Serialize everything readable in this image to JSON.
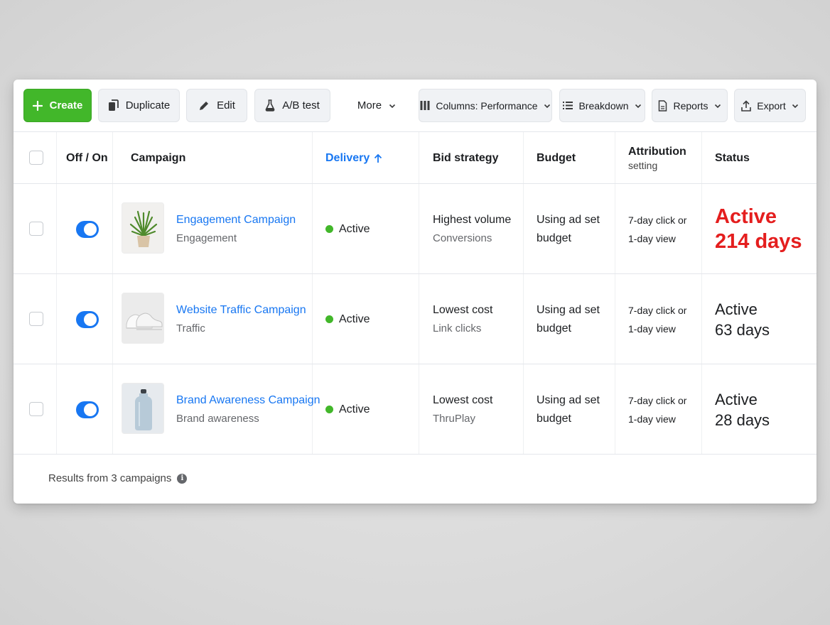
{
  "toolbar": {
    "create_label": "Create",
    "duplicate_label": "Duplicate",
    "edit_label": "Edit",
    "ab_test_label": "A/B test",
    "more_label": "More",
    "columns_label": "Columns: Performance",
    "breakdown_label": "Breakdown",
    "reports_label": "Reports",
    "export_label": "Export"
  },
  "table": {
    "headers": {
      "off_on": "Off / On",
      "campaign": "Campaign",
      "delivery": "Delivery",
      "bid_strategy": "Bid strategy",
      "budget": "Budget",
      "attribution": "Attribution",
      "attribution_sub": "setting",
      "status": "Status"
    },
    "rows": [
      {
        "name": "Engagement Campaign",
        "objective": "Engagement",
        "thumbnail": "plant",
        "enabled": true,
        "delivery": "Active",
        "bid_strategy": "Highest volume",
        "bid_sub": "Conversions",
        "budget_line1": "Using ad set",
        "budget_line2": "budget",
        "attribution_line1": "7-day click or",
        "attribution_line2": "1-day view",
        "status_line1": "Active",
        "status_line2": "214 days",
        "status_color": "#e41e1e"
      },
      {
        "name": "Website Traffic Campaign",
        "objective": "Traffic",
        "thumbnail": "sneakers",
        "enabled": true,
        "delivery": "Active",
        "bid_strategy": "Lowest cost",
        "bid_sub": "Link clicks",
        "budget_line1": "Using ad set",
        "budget_line2": "budget",
        "attribution_line1": "7-day click or",
        "attribution_line2": "1-day view",
        "status_line1": "Active",
        "status_line2": "63 days"
      },
      {
        "name": "Brand Awareness Campaign",
        "objective": "Brand awareness",
        "thumbnail": "water-bottle",
        "enabled": true,
        "delivery": "Active",
        "bid_strategy": "Lowest cost",
        "bid_sub": "ThruPlay",
        "budget_line1": "Using ad set",
        "budget_line2": "budget",
        "attribution_line1": "7-day click or",
        "attribution_line2": "1-day view",
        "status_line1": "Active",
        "status_line2": "28 days"
      }
    ]
  },
  "footer": {
    "results_text": "Results from 3 campaigns"
  },
  "colors": {
    "primary_green": "#42b72a",
    "link_blue": "#1877f2",
    "alert_red": "#e41e1e",
    "delivery_dot": "#42b72a"
  }
}
